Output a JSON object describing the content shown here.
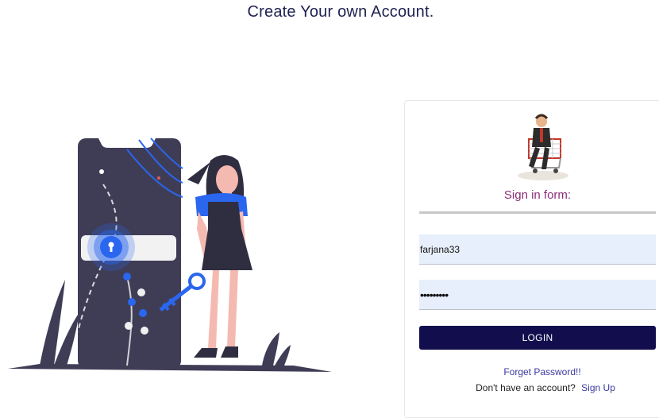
{
  "page": {
    "title": "Create Your own Account."
  },
  "form": {
    "title": "Sign in form:",
    "username_value": "farjana33",
    "password_value": "•••••••••",
    "login_label": "LOGIN",
    "forgot_label": "Forget Password!!",
    "no_account_text": "Don't have an account?",
    "signup_label": "Sign Up"
  },
  "colors": {
    "title_text": "#1e2150",
    "form_title": "#8a2e77",
    "button_bg": "#120e4e",
    "input_bg": "#e8effc",
    "link": "#3a3aa0",
    "phone": "#3f3d56",
    "accent_blue": "#2a66ee"
  },
  "icons": {
    "avatar": "shopping-cart-person-avatar",
    "illustration": "phone-lock-key-illustration"
  }
}
